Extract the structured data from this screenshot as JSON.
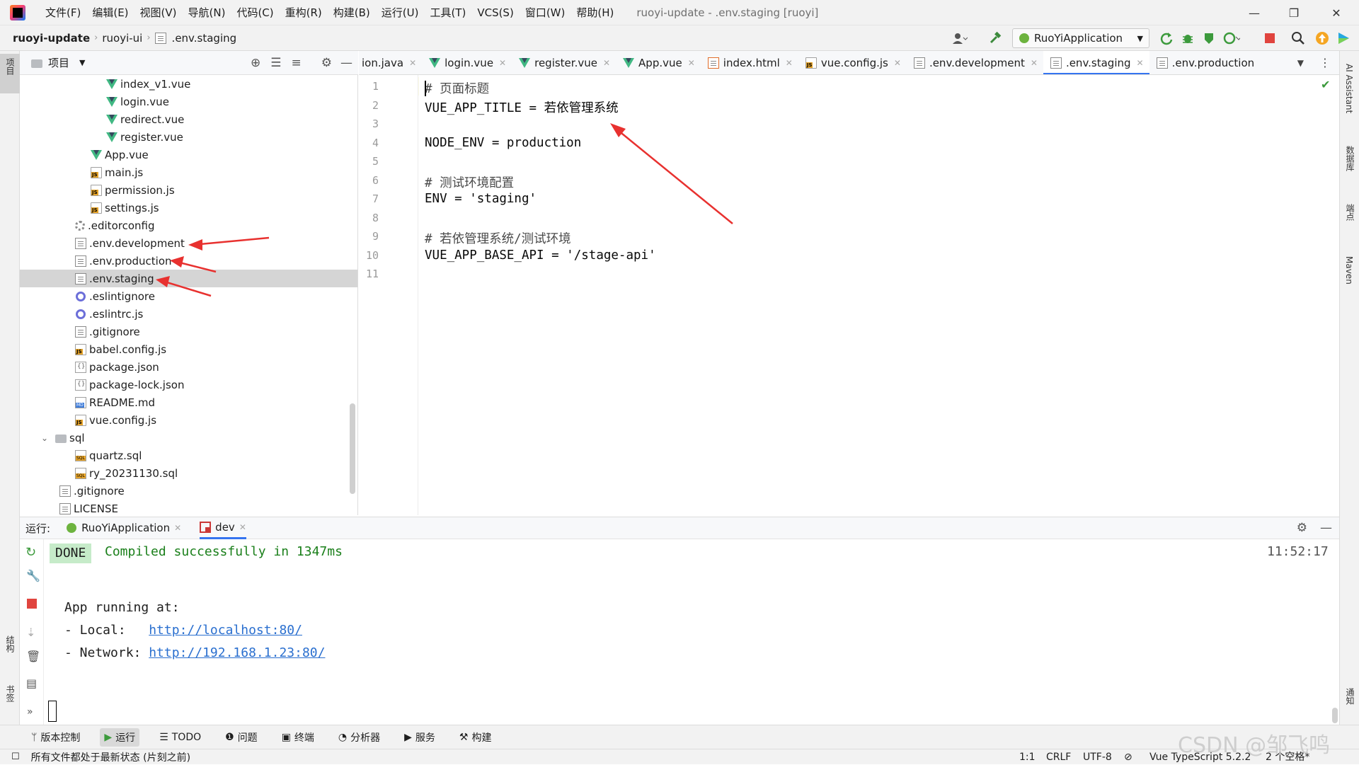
{
  "titlebar": {
    "menus": [
      "文件(F)",
      "编辑(E)",
      "视图(V)",
      "导航(N)",
      "代码(C)",
      "重构(R)",
      "构建(B)",
      "运行(U)",
      "工具(T)",
      "VCS(S)",
      "窗口(W)",
      "帮助(H)"
    ],
    "window_title": "ruoyi-update - .env.staging [ruoyi]"
  },
  "breadcrumb": [
    "ruoyi-update",
    "ruoyi-ui",
    ".env.staging"
  ],
  "toolbar": {
    "run_config": "RuoYiApplication"
  },
  "left_strip": {
    "project": "项目",
    "structure": "结构",
    "bookmarks": "书签"
  },
  "right_strip": {
    "ai": "AI Assistant",
    "database": "数据库",
    "endpoints": "端点",
    "maven": "Maven",
    "notifications": "通知"
  },
  "project_panel": {
    "title": "项目"
  },
  "tree": [
    {
      "label": "index_v1.vue",
      "icon": "vue"
    },
    {
      "label": "login.vue",
      "icon": "vue"
    },
    {
      "label": "redirect.vue",
      "icon": "vue"
    },
    {
      "label": "register.vue",
      "icon": "vue"
    },
    {
      "label": "App.vue",
      "icon": "vue"
    },
    {
      "label": "main.js",
      "icon": "js"
    },
    {
      "label": "permission.js",
      "icon": "js"
    },
    {
      "label": "settings.js",
      "icon": "js"
    },
    {
      "label": ".editorconfig",
      "icon": "gear"
    },
    {
      "label": ".env.development",
      "icon": "doc"
    },
    {
      "label": ".env.production",
      "icon": "doc"
    },
    {
      "label": ".env.staging",
      "icon": "doc",
      "selected": true
    },
    {
      "label": ".eslintignore",
      "icon": "eslint"
    },
    {
      "label": ".eslintrc.js",
      "icon": "eslint"
    },
    {
      "label": ".gitignore",
      "icon": "doc"
    },
    {
      "label": "babel.config.js",
      "icon": "js"
    },
    {
      "label": "package.json",
      "icon": "json"
    },
    {
      "label": "package-lock.json",
      "icon": "json"
    },
    {
      "label": "README.md",
      "icon": "md"
    },
    {
      "label": "vue.config.js",
      "icon": "js"
    },
    {
      "label": "sql",
      "icon": "folder",
      "expanded": true
    },
    {
      "label": "quartz.sql",
      "icon": "sql"
    },
    {
      "label": "ry_20231130.sql",
      "icon": "sql"
    },
    {
      "label": ".gitignore",
      "icon": "doc"
    },
    {
      "label": "LICENSE",
      "icon": "doc"
    }
  ],
  "tabs": [
    {
      "label": "ion.java",
      "icon": "none"
    },
    {
      "label": "login.vue",
      "icon": "vue"
    },
    {
      "label": "register.vue",
      "icon": "vue"
    },
    {
      "label": "App.vue",
      "icon": "vue"
    },
    {
      "label": "index.html",
      "icon": "html"
    },
    {
      "label": "vue.config.js",
      "icon": "js"
    },
    {
      "label": ".env.development",
      "icon": "doc"
    },
    {
      "label": ".env.staging",
      "icon": "doc",
      "active": true
    },
    {
      "label": ".env.production",
      "icon": "doc"
    }
  ],
  "editor": {
    "lines": [
      "# 页面标题",
      "VUE_APP_TITLE = 若依管理系统",
      "",
      "NODE_ENV = production",
      "",
      "# 测试环境配置",
      "ENV = 'staging'",
      "",
      "# 若依管理系统/测试环境",
      "VUE_APP_BASE_API = '/stage-api'",
      ""
    ]
  },
  "run_panel": {
    "label": "运行:",
    "tabs": [
      "RuoYiApplication",
      "dev"
    ],
    "done": "DONE",
    "compiled": "Compiled successfully in 1347ms",
    "time": "11:52:17",
    "app_running": "App running at:",
    "local_label": "- Local:   ",
    "local_url": "http://localhost:80/",
    "network_label": "- Network: ",
    "network_url": "http://192.168.1.23:80/"
  },
  "tool_windows": [
    "版本控制",
    "运行",
    "TODO",
    "问题",
    "终端",
    "分析器",
    "服务",
    "构建"
  ],
  "status": {
    "message": "所有文件都处于最新状态 (片刻之前)",
    "position": "1:1",
    "line_sep": "CRLF",
    "encoding": "UTF-8",
    "language": "Vue TypeScript 5.2.2",
    "indent": "2 个空格*"
  },
  "watermark": "CSDN @邹飞鸣",
  "colors": {
    "accent": "#3574f0",
    "arrow": "#e8312f",
    "done_bg": "#c6ebc9",
    "compiled": "#1a7f1a",
    "link": "#2a6fcf"
  }
}
